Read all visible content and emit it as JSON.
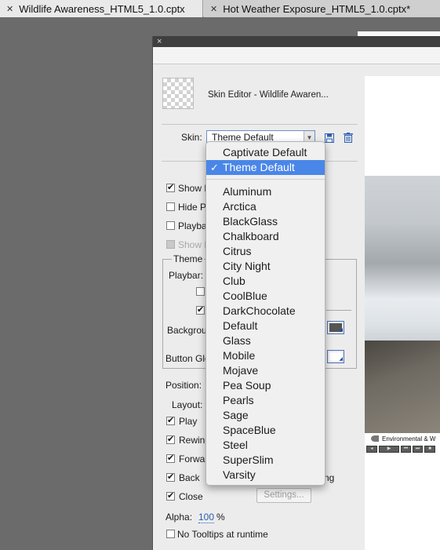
{
  "tabs": [
    {
      "label": "Wildlife Awareness_HTML5_1.0.cptx"
    },
    {
      "label": "Hot Weather Exposure_HTML5_1.0.cptx*"
    }
  ],
  "dialog": {
    "close_glyph": "×",
    "title": "Skin Editor - Wildlife Awaren...",
    "skin_label": "Skin:",
    "skin_value": "Theme Default"
  },
  "checkboxes": {
    "show_playback": {
      "label": "Show P",
      "checked": true
    },
    "hide_playbar": {
      "label": "Hide Pl",
      "checked": false
    },
    "playbar": {
      "label": "Playbar",
      "checked": false
    },
    "show_disabled": {
      "label": "Show P",
      "checked": false
    }
  },
  "theme": {
    "legend": "Theme",
    "playbar_label": "Playbar:",
    "background_label": "Backgrou",
    "button_glow_label": "Button Glo",
    "background_color": "#555555",
    "button_glow_color": "#ffffff"
  },
  "position": {
    "label": "Position:",
    "layout_label": "Layout:"
  },
  "controls": [
    {
      "label": "Play",
      "checked": true
    },
    {
      "label": "Rewind",
      "checked": true
    },
    {
      "label": "Forwar",
      "checked": true
    },
    {
      "label": "Back",
      "checked": true
    },
    {
      "label": "Close",
      "checked": true
    }
  ],
  "back_row_suffix": "ng",
  "settings_label": "Settings...",
  "alpha": {
    "label": "Alpha:",
    "value": "100",
    "unit": "%"
  },
  "no_tooltips": {
    "label": "No Tooltips at runtime",
    "checked": false
  },
  "preview": {
    "caption": "Environmental & W"
  },
  "dropdown": {
    "top_items": [
      "Captivate Default",
      "Theme Default"
    ],
    "selected": "Theme Default",
    "items": [
      "Aluminum",
      "Arctica",
      "BlackGlass",
      "Chalkboard",
      "Citrus",
      "City Night",
      "Club",
      "CoolBlue",
      "DarkChocolate",
      "Default",
      "Glass",
      "Mobile",
      "Mojave",
      "Pea Soup",
      "Pearls",
      "Sage",
      "SpaceBlue",
      "Steel",
      "SuperSlim",
      "Varsity"
    ]
  },
  "colors": {
    "selection": "#4a86e8",
    "link": "#2a5db0"
  }
}
